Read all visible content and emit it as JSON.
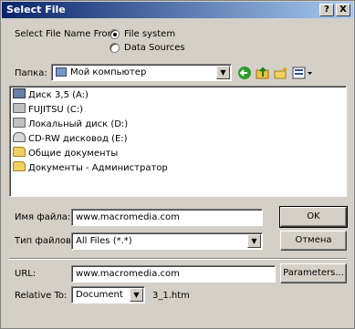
{
  "window": {
    "title": "Select File",
    "help_btn": "?",
    "close_btn": "X"
  },
  "source": {
    "label": "Select File Name From:",
    "options": [
      "File system",
      "Data Sources"
    ],
    "selected": 0
  },
  "lookin": {
    "label": "Папка:",
    "value": "Мой компьютер"
  },
  "files": [
    {
      "name": "Диск 3,5 (A:)",
      "icon": "floppy-icon"
    },
    {
      "name": "FUJITSU (C:)",
      "icon": "drive-icon"
    },
    {
      "name": "Локальный диск (D:)",
      "icon": "drive-icon"
    },
    {
      "name": "CD-RW дисковод (E:)",
      "icon": "cd-drive-icon"
    },
    {
      "name": "Общие документы",
      "icon": "folder-icon"
    },
    {
      "name": "Документы - Администратор",
      "icon": "folder-icon"
    }
  ],
  "filename": {
    "label": "Имя файла:",
    "value": "www.macromedia.com"
  },
  "filetype": {
    "label": "Тип файлов:",
    "value": "All Files (*.*)"
  },
  "buttons": {
    "ok": "OK",
    "cancel": "Отмена",
    "parameters": "Parameters..."
  },
  "url": {
    "label": "URL:",
    "value": "www.macromedia.com"
  },
  "relative": {
    "label": "Relative To:",
    "value": "Document",
    "suffix": "3_1.htm"
  }
}
